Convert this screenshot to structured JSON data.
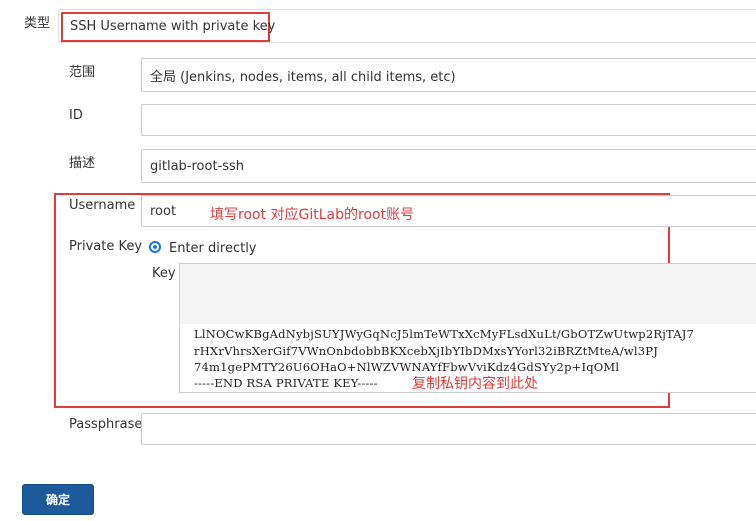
{
  "form": {
    "kind": {
      "label": "类型",
      "value": "SSH Username with private key"
    },
    "scope": {
      "label": "范围",
      "value": "全局 (Jenkins, nodes, items, all child items, etc)"
    },
    "id": {
      "label": "ID",
      "value": ""
    },
    "description": {
      "label": "描述",
      "value": "gitlab-root-ssh"
    },
    "username": {
      "label": "Username",
      "value": "root"
    },
    "private_key": {
      "label": "Private Key",
      "option_label": "Enter directly",
      "key_label": "Key",
      "key_lines": [
        "LlNOCwKBgAdNybjSUYJWyGqNcJ5lmTeWTxXcMyFLsdXuLt/GbOTZwUtwp2RjTAJ7",
        "rHXrVhrsXerGif7VWnOnbdobbBKXcebXjIbYIbDMxsYYorl32iBRZtMteA/wl3PJ",
        "74m1gePMTY26U6OHaO+NlWZVWNAYfFbwVviKdz4GdSYy2p+IqOMl",
        "-----END RSA PRIVATE KEY-----"
      ]
    },
    "passphrase": {
      "label": "Passphrase",
      "value": ""
    },
    "submit_label": "确定"
  },
  "annotations": {
    "username_note": "填写root 对应GitLab的root账号",
    "key_note": "复制私钥内容到此处"
  },
  "colors": {
    "annotation_red": "#e03c3c",
    "button_blue": "#1d5a9c",
    "radio_blue": "#1a73e8"
  }
}
